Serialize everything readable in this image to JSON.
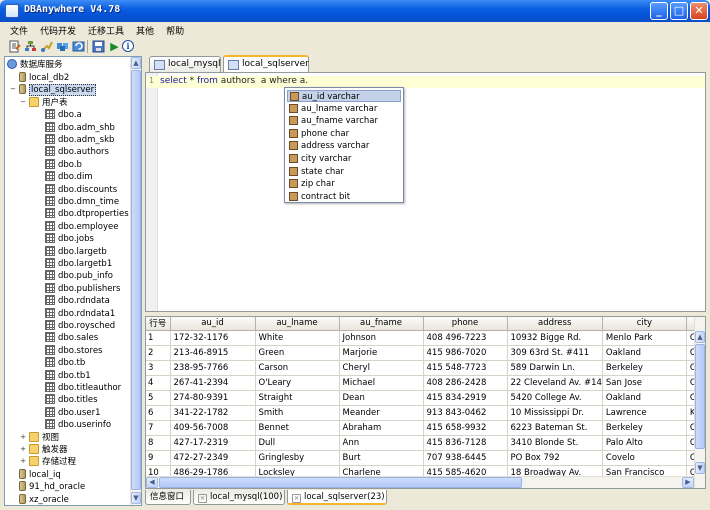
{
  "window": {
    "title": "DBAnywhere V4.78",
    "min": "_",
    "max": "□",
    "close": "✕"
  },
  "menu": [
    "文件",
    "代码开发",
    "迁移工具",
    "其他",
    "帮助"
  ],
  "toolbar": {
    "icons": [
      "new-script-icon",
      "schema-icon",
      "connect-icon",
      "disconnect-icon",
      "refresh-icon",
      "save-icon",
      "run-icon",
      "info-icon"
    ],
    "run_glyph": "▶",
    "info_glyph": "i"
  },
  "tree": {
    "root": "数据库服务",
    "items": [
      {
        "label": "local_db2",
        "kind": "db"
      },
      {
        "label": "local_sqlserver",
        "kind": "db",
        "selected": true
      },
      {
        "label": "用户表",
        "kind": "folder"
      },
      {
        "label": "dbo.a",
        "kind": "table"
      },
      {
        "label": "dbo.adm_shb",
        "kind": "table"
      },
      {
        "label": "dbo.adm_skb",
        "kind": "table"
      },
      {
        "label": "dbo.authors",
        "kind": "table"
      },
      {
        "label": "dbo.b",
        "kind": "table"
      },
      {
        "label": "dbo.dim",
        "kind": "table"
      },
      {
        "label": "dbo.discounts",
        "kind": "table"
      },
      {
        "label": "dbo.dmn_time",
        "kind": "table"
      },
      {
        "label": "dbo.dtproperties",
        "kind": "table"
      },
      {
        "label": "dbo.employee",
        "kind": "table"
      },
      {
        "label": "dbo.jobs",
        "kind": "table"
      },
      {
        "label": "dbo.largetb",
        "kind": "table"
      },
      {
        "label": "dbo.largetb1",
        "kind": "table"
      },
      {
        "label": "dbo.pub_info",
        "kind": "table"
      },
      {
        "label": "dbo.publishers",
        "kind": "table"
      },
      {
        "label": "dbo.rdndata",
        "kind": "table"
      },
      {
        "label": "dbo.rdndata1",
        "kind": "table"
      },
      {
        "label": "dbo.roysched",
        "kind": "table"
      },
      {
        "label": "dbo.sales",
        "kind": "table"
      },
      {
        "label": "dbo.stores",
        "kind": "table"
      },
      {
        "label": "dbo.tb",
        "kind": "table"
      },
      {
        "label": "dbo.tb1",
        "kind": "table"
      },
      {
        "label": "dbo.titleauthor",
        "kind": "table"
      },
      {
        "label": "dbo.titles",
        "kind": "table"
      },
      {
        "label": "dbo.user1",
        "kind": "table"
      },
      {
        "label": "dbo.userinfo",
        "kind": "table"
      },
      {
        "label": "视图",
        "kind": "folder"
      },
      {
        "label": "触发器",
        "kind": "folder"
      },
      {
        "label": "存储过程",
        "kind": "folder"
      },
      {
        "label": "local_iq",
        "kind": "db"
      },
      {
        "label": "91_hd_oracle",
        "kind": "db"
      },
      {
        "label": "xz_oracle",
        "kind": "db"
      }
    ]
  },
  "editor": {
    "tabs": [
      "local_mysql",
      "local_sqlserver"
    ],
    "active_tab": "local_sqlserver",
    "line_number": "1",
    "code": {
      "kw1": "select",
      "star": " * ",
      "kw2": "from",
      "rest": " authors  a where a."
    }
  },
  "autocomplete": [
    "au_id varchar",
    "au_lname varchar",
    "au_fname varchar",
    "phone char",
    "address varchar",
    "city varchar",
    "state char",
    "zip char",
    "contract bit"
  ],
  "grid": {
    "columns": [
      "行号",
      "au_id",
      "au_lname",
      "au_fname",
      "phone",
      "address",
      "city",
      ""
    ],
    "rows": [
      [
        "1",
        "172-32-1176",
        "White",
        "Johnson",
        "408 496-7223",
        "10932 Bigge Rd.",
        "Menlo Park",
        "CA"
      ],
      [
        "2",
        "213-46-8915",
        "Green",
        "Marjorie",
        "415 986-7020",
        "309 63rd St. #411",
        "Oakland",
        "CA"
      ],
      [
        "3",
        "238-95-7766",
        "Carson",
        "Cheryl",
        "415 548-7723",
        "589 Darwin Ln.",
        "Berkeley",
        "CA"
      ],
      [
        "4",
        "267-41-2394",
        "O'Leary",
        "Michael",
        "408 286-2428",
        "22 Cleveland Av. #14",
        "San Jose",
        "CA"
      ],
      [
        "5",
        "274-80-9391",
        "Straight",
        "Dean",
        "415 834-2919",
        "5420 College Av.",
        "Oakland",
        "CA"
      ],
      [
        "6",
        "341-22-1782",
        "Smith",
        "Meander",
        "913 843-0462",
        "10 Mississippi Dr.",
        "Lawrence",
        "KS"
      ],
      [
        "7",
        "409-56-7008",
        "Bennet",
        "Abraham",
        "415 658-9932",
        "6223 Bateman St.",
        "Berkeley",
        "CA"
      ],
      [
        "8",
        "427-17-2319",
        "Dull",
        "Ann",
        "415 836-7128",
        "3410 Blonde St.",
        "Palo Alto",
        "CA"
      ],
      [
        "9",
        "472-27-2349",
        "Gringlesby",
        "Burt",
        "707 938-6445",
        "PO Box 792",
        "Covelo",
        "CA"
      ],
      [
        "10",
        "486-29-1786",
        "Locksley",
        "Charlene",
        "415 585-4620",
        "18 Broadway Av.",
        "San Francisco",
        "CA"
      ]
    ]
  },
  "bottom_tabs": [
    "信息窗口",
    "local_mysql(100)",
    "local_sqlserver(23)"
  ],
  "scroll": {
    "up": "▲",
    "down": "▼",
    "left": "◀",
    "right": "▶"
  }
}
